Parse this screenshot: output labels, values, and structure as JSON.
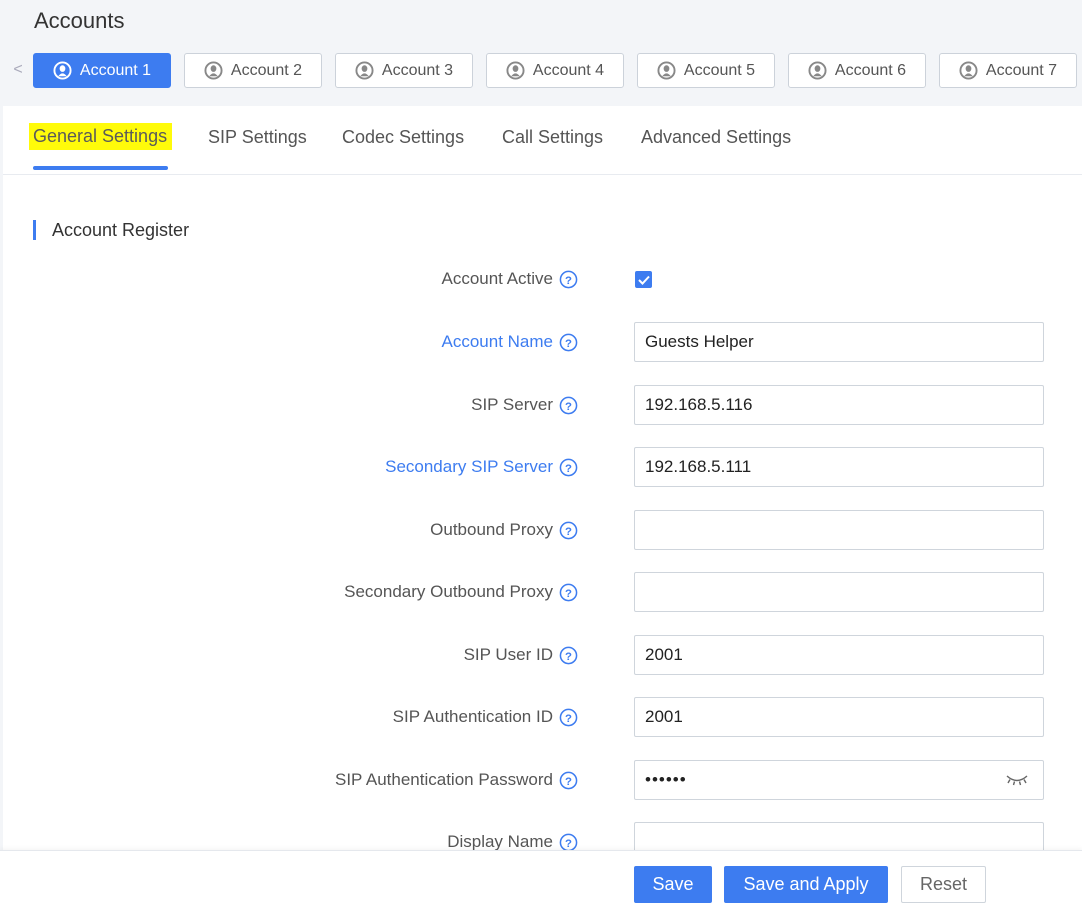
{
  "page": {
    "title": "Accounts"
  },
  "account_tabs": {
    "scroll_left": "<",
    "items": [
      {
        "label": "Account 1",
        "active": true
      },
      {
        "label": "Account 2"
      },
      {
        "label": "Account 3"
      },
      {
        "label": "Account 4"
      },
      {
        "label": "Account 5"
      },
      {
        "label": "Account 6"
      },
      {
        "label": "Account 7"
      }
    ]
  },
  "settings_tabs": [
    {
      "label": "General Settings",
      "active": true
    },
    {
      "label": "SIP Settings"
    },
    {
      "label": "Codec Settings"
    },
    {
      "label": "Call Settings"
    },
    {
      "label": "Advanced Settings"
    }
  ],
  "section": {
    "title": "Account Register"
  },
  "fields": {
    "account_active": {
      "label": "Account Active",
      "checked": true
    },
    "account_name": {
      "label": "Account Name",
      "value": "Guests Helper"
    },
    "sip_server": {
      "label": "SIP Server",
      "value": "192.168.5.116"
    },
    "secondary_sip_server": {
      "label": "Secondary SIP Server",
      "value": "192.168.5.111"
    },
    "outbound_proxy": {
      "label": "Outbound Proxy",
      "value": ""
    },
    "secondary_outbound_proxy": {
      "label": "Secondary Outbound Proxy",
      "value": ""
    },
    "sip_user_id": {
      "label": "SIP User ID",
      "value": "2001"
    },
    "sip_auth_id": {
      "label": "SIP Authentication ID",
      "value": "2001"
    },
    "sip_auth_password": {
      "label": "SIP Authentication Password",
      "value": "••••••"
    },
    "display_name": {
      "label": "Display Name",
      "value": ""
    }
  },
  "footer": {
    "save": "Save",
    "save_apply": "Save and Apply",
    "reset": "Reset"
  },
  "colors": {
    "accent": "#3d7cf0",
    "highlight": "#fffb0a"
  }
}
